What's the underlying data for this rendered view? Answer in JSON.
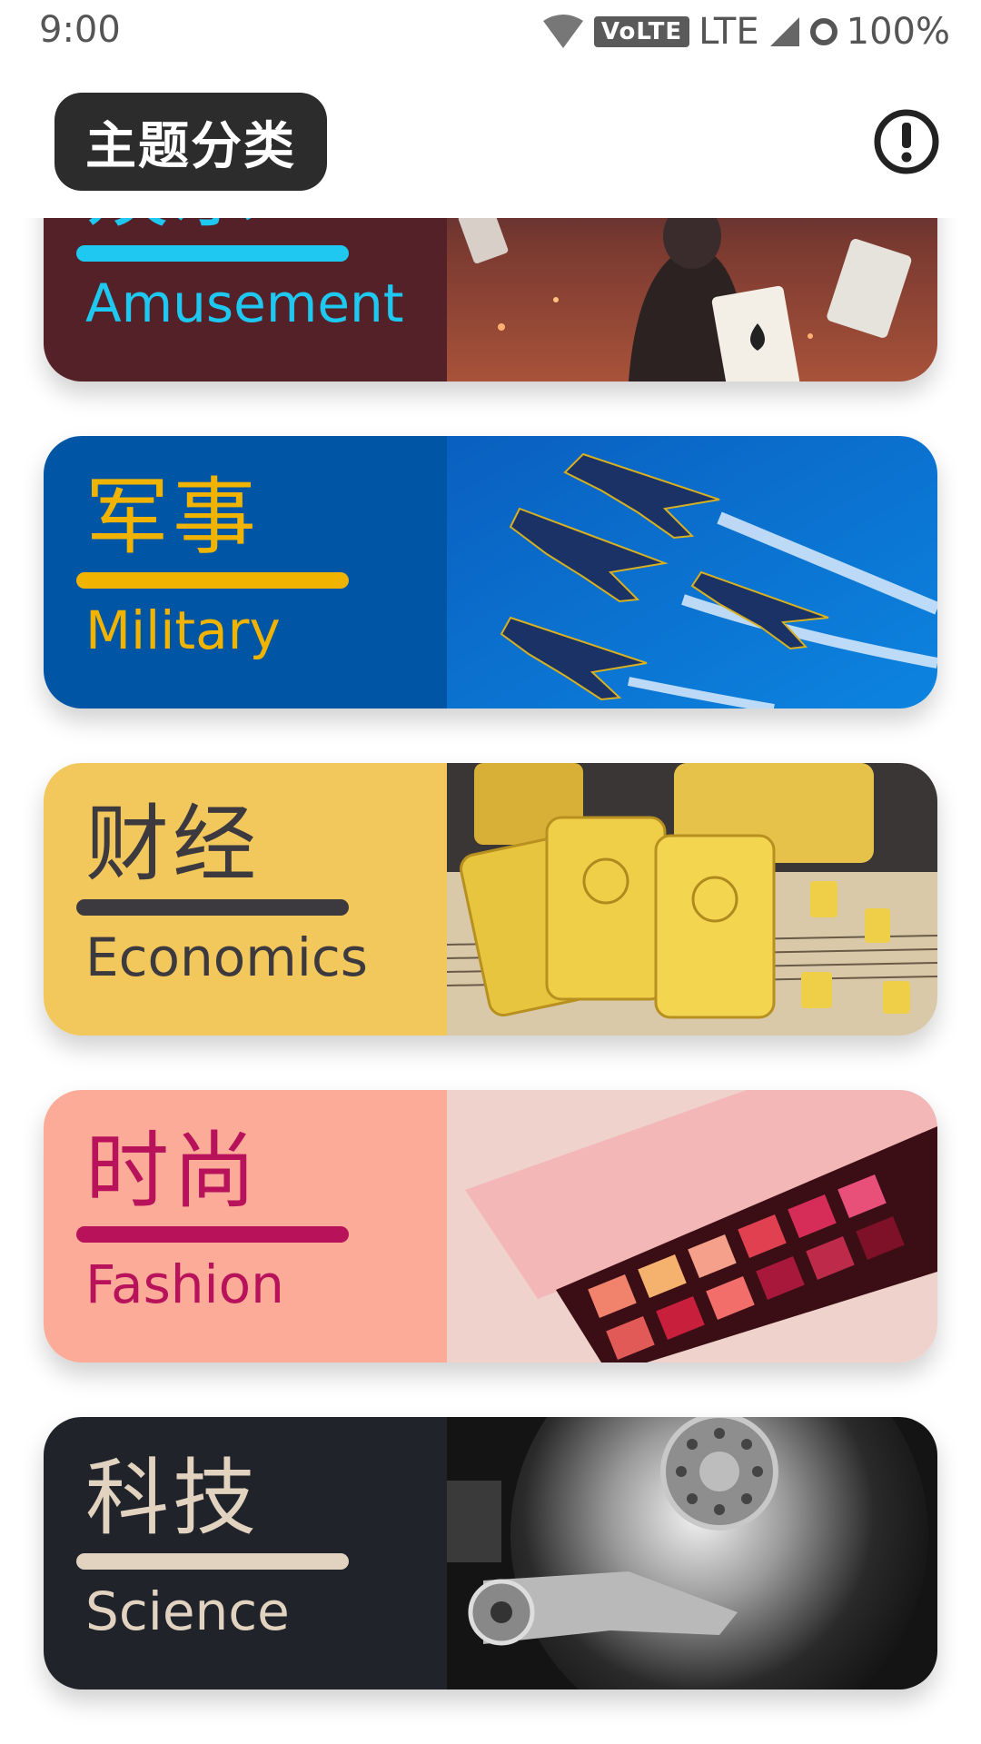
{
  "status_bar": {
    "time": "9:00",
    "volte": "VoLTE",
    "network": "LTE",
    "battery": "100%"
  },
  "app_bar": {
    "title": "主题分类",
    "info_icon": "info-alert-icon"
  },
  "categories": [
    {
      "cn": "娱乐",
      "en": "Amusement",
      "bg": "#542128",
      "accent": "#1ec8f0",
      "image": "playing-cards-photo"
    },
    {
      "cn": "军事",
      "en": "Military",
      "bg": "#0055a4",
      "accent": "#f0b400",
      "image": "fighter-jets-photo"
    },
    {
      "cn": "财经",
      "en": "Economics",
      "bg": "#f2c75c",
      "accent": "#3c3a3e",
      "image": "gold-bars-photo"
    },
    {
      "cn": "时尚",
      "en": "Fashion",
      "bg": "#fbab98",
      "accent": "#b8125a",
      "image": "eyeshadow-palette-photo"
    },
    {
      "cn": "科技",
      "en": "Science",
      "bg": "#20232a",
      "accent": "#e2d2c0",
      "image": "hard-drive-photo"
    }
  ]
}
